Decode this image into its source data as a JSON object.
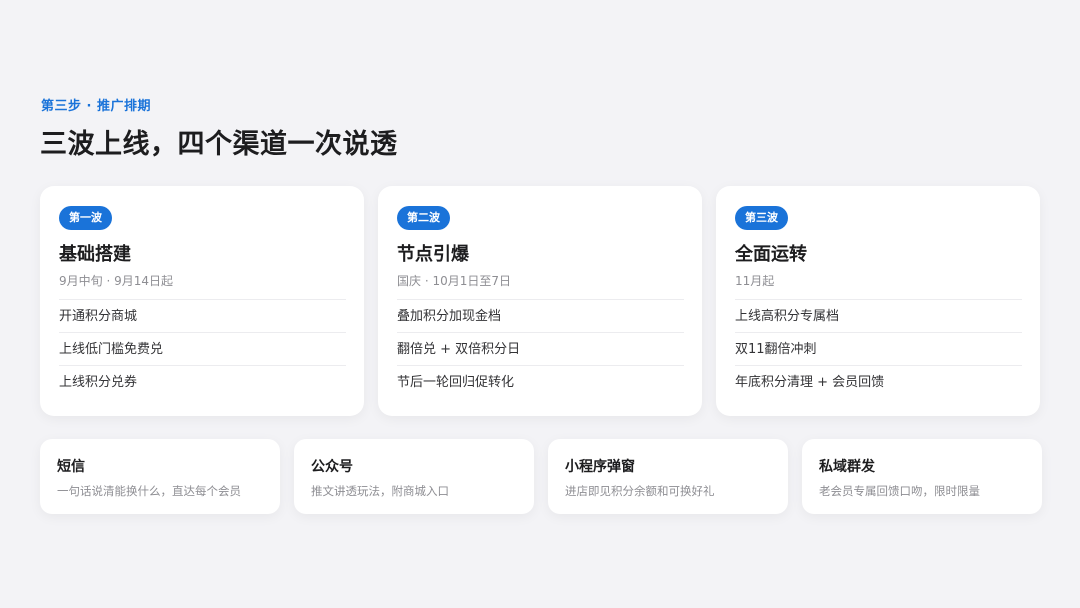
{
  "header": {
    "step_label": "第三步 · 推广排期",
    "headline": "三波上线，四个渠道一次说透"
  },
  "waves": [
    {
      "badge": "第一波",
      "title": "基础搭建",
      "date": "9月中旬 · 9月14日起",
      "items": [
        "开通积分商城",
        "上线低门槛免费兑",
        "上线积分兑券"
      ]
    },
    {
      "badge": "第二波",
      "title": "节点引爆",
      "date": "国庆 · 10月1日至7日",
      "items": [
        "叠加积分加现金档",
        "翻倍兑 + 双倍积分日",
        "节后一轮回归促转化"
      ]
    },
    {
      "badge": "第三波",
      "title": "全面运转",
      "date": "11月起",
      "items": [
        "上线高积分专属档",
        "双11翻倍冲刺",
        "年底积分清理 + 会员回馈"
      ]
    }
  ],
  "channels": [
    {
      "title": "短信",
      "desc": "一句话说清能换什么，直达每个会员"
    },
    {
      "title": "公众号",
      "desc": "推文讲透玩法，附商城入口"
    },
    {
      "title": "小程序弹窗",
      "desc": "进店即见积分余额和可换好礼"
    },
    {
      "title": "私域群发",
      "desc": "老会员专属回馈口吻，限时限量"
    }
  ],
  "colors": {
    "accent": "#1a73d9",
    "background": "#f3f3f6",
    "card": "#ffffff",
    "muted_text": "#8e8e93"
  }
}
